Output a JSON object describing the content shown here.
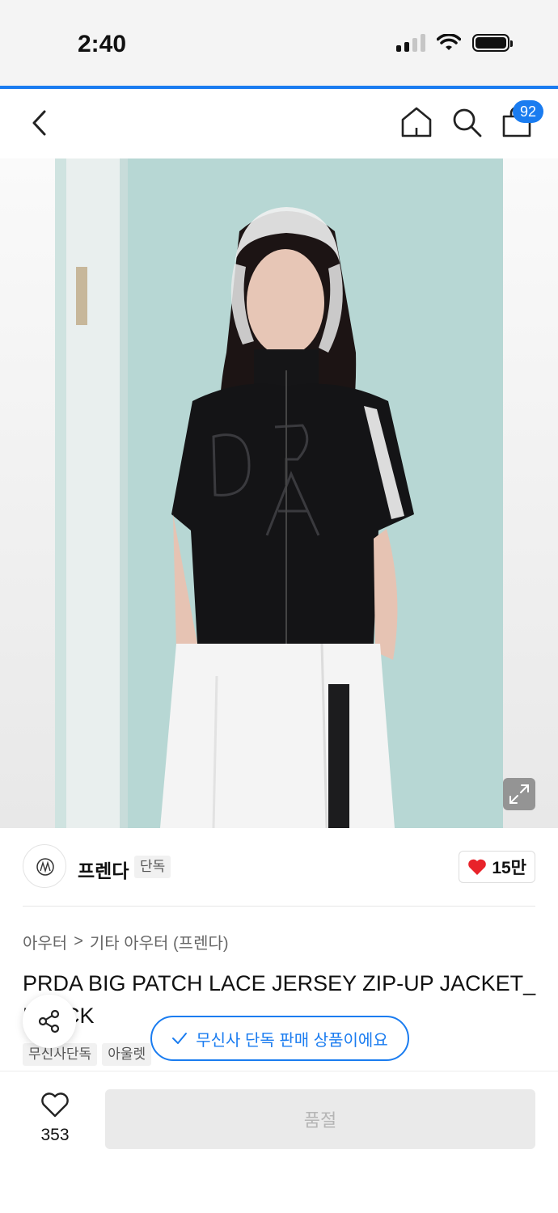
{
  "status_bar": {
    "time": "2:40"
  },
  "nav": {
    "cart_count": "92"
  },
  "brand": {
    "name": "프렌다",
    "exclusive_label": "단독",
    "like_count": "15만"
  },
  "breadcrumb": {
    "category": "아우터",
    "separator": ">",
    "subcategory": "기타 아우터 (프렌다)"
  },
  "product": {
    "title": "PRDA BIG PATCH LACE JERSEY ZIP-UP JACKET_BLACK",
    "tags": [
      "무신사단독",
      "아울렛"
    ]
  },
  "toast": {
    "message": "무신사 단독 판매 상품이에요"
  },
  "bottom": {
    "wish_count": "353",
    "buy_label": "품절"
  },
  "colors": {
    "accent": "#1a7cf0",
    "heart": "#e8232a",
    "disabled": "#eaeaea"
  }
}
